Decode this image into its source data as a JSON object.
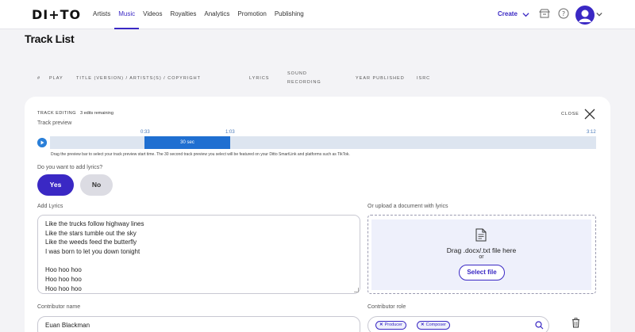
{
  "brand": {
    "logo": "DI+TO",
    "accent": "#3a28c4",
    "preview_blue": "#1f6fd1"
  },
  "nav": {
    "items": [
      "Artists",
      "Music",
      "Videos",
      "Royalties",
      "Analytics",
      "Promotion",
      "Publishing"
    ],
    "active": "Music",
    "create_label": "Create"
  },
  "page": {
    "title": "Track List"
  },
  "table_header": {
    "number": "#",
    "play": "PLAY",
    "title": "TITLE (VERSION) / ARTISTS(S) / COPYRIGHT",
    "lyrics": "LYRICS",
    "sound_recording_1": "SOUND",
    "sound_recording_2": "RECORDING",
    "year": "YEAR PUBLISHED",
    "isrc": "ISRC"
  },
  "editor": {
    "heading": "TRACK EDITING",
    "edits_remaining": "3 edits remaining",
    "close_label": "CLOSE",
    "preview_label": "Track preview",
    "preview_start": "0:33",
    "preview_end": "1:03",
    "track_end": "3:12",
    "preview_window_label": "30 sec",
    "preview_help": "Drag the preview bar to select your track preview start time. The 30 second track preview you select will be featured on your Ditto SmartLink and platforms such as TikTok.",
    "lyrics_question": "Do you want to add lyrics?",
    "yes_label": "Yes",
    "no_label": "No",
    "add_lyrics_label": "Add Lyrics",
    "lyrics_lines": [
      "Like the trucks follow highway lines",
      "Like the stars tumble out the sky",
      "Like the weeds feed the butterfly",
      "I was born to let you down tonight",
      "",
      "Hoo hoo hoo",
      "Hoo hoo hoo",
      "Hoo hoo hoo"
    ],
    "upload_label": "Or upload a document with lyrics",
    "drop_text": "Drag .docx/.txt file here",
    "or_text": "or",
    "select_file_label": "Select file",
    "contributor_name_label": "Contributor name",
    "contributor_name_value": "Euan Blackman",
    "contributor_role_label": "Contributor role",
    "roles": [
      "Producer",
      "Composer"
    ]
  },
  "icons": {
    "chevron": "chevron-down-icon",
    "store": "store-icon",
    "help": "help-icon",
    "avatar": "avatar",
    "close": "close-icon",
    "play": "play-icon",
    "document": "document-icon",
    "search": "search-icon",
    "delete": "trash-icon"
  }
}
